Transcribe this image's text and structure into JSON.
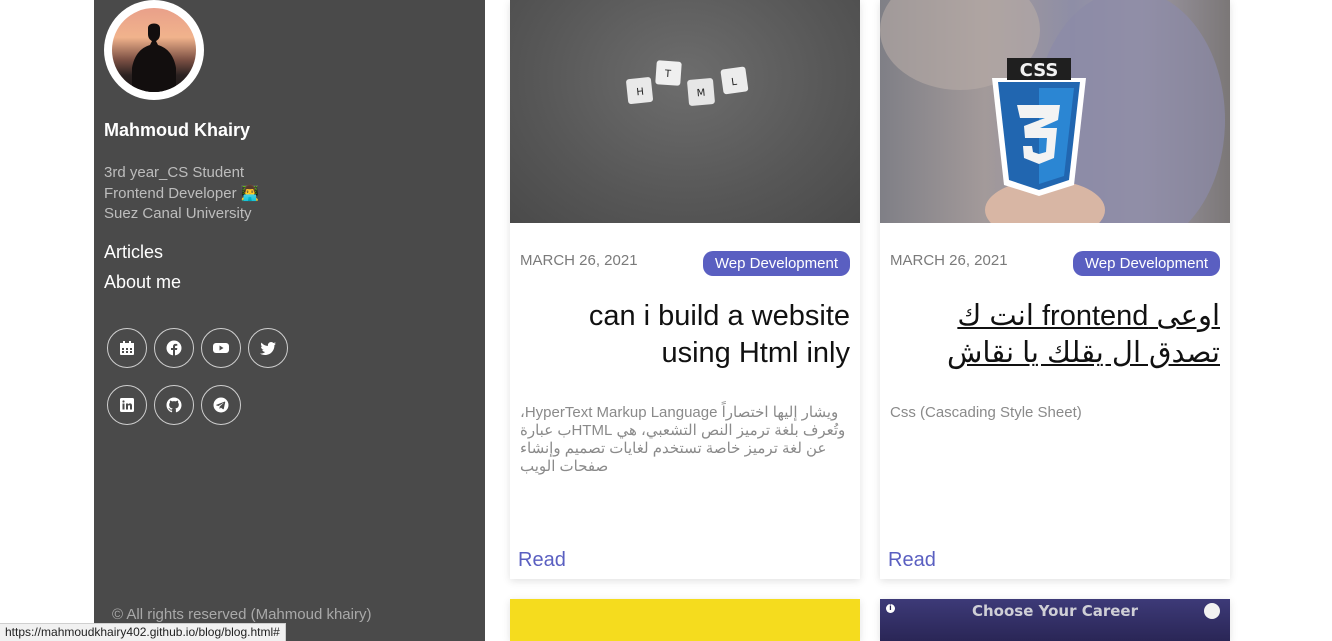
{
  "profile": {
    "name": "Mahmoud Khairy",
    "bio": [
      "3rd year_CS Student",
      "Frontend Developer 👨‍💻",
      "Suez Canal University"
    ]
  },
  "nav": {
    "articles": "Articles",
    "about": "About me"
  },
  "socials": {
    "row1": [
      "calendar-icon",
      "facebook-icon",
      "youtube-icon",
      "twitter-icon"
    ],
    "row2": [
      "linkedin-icon",
      "github-icon",
      "telegram-icon"
    ]
  },
  "footer": "© All rights reserved (Mahmoud khairy)",
  "cards": [
    {
      "date": "MARCH 26, 2021",
      "tag": "Wep Development",
      "title": "can i build a website using Html inly",
      "excerpt": "ويشار إليها اختصاراً HyperText Markup Language، وتُعرف بلغة ترميز النص التشعبي، هي HTMLب عبارة عن لغة ترميز خاصة تستخدم لغايات تصميم وإنشاء صفحات الويب",
      "read": "Read",
      "thumb_tiles": [
        "H",
        "T",
        "M",
        "L"
      ]
    },
    {
      "date": "MARCH 26, 2021",
      "tag": "Wep Development",
      "title": "اوعى frontend انت ك تصدق ال يقلك يا نقاش",
      "excerpt": "Css (Cascading Style Sheet)",
      "read": "Read",
      "thumb_badge": "CSS"
    },
    {},
    {
      "thumb_text": "Choose Your Career"
    }
  ],
  "status_bar_url": "https://mahmoudkhairy402.github.io/blog/blog.html#",
  "colors": {
    "sidebar": "#4a4a4a",
    "accent": "#5a5fc1",
    "bg": "#ffffff"
  }
}
